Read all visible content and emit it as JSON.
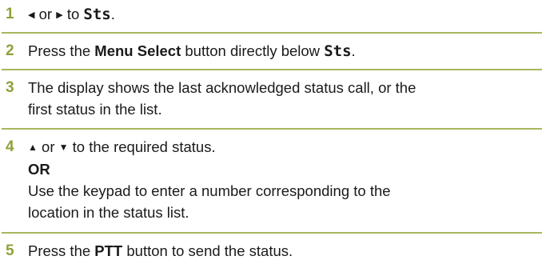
{
  "colors": {
    "accent": "#8fa13a",
    "rule": "#a8b85a",
    "text": "#1a1a1a"
  },
  "steps": [
    {
      "number": "1",
      "left_arrow_icon": "left-triangle-icon",
      "left_arrow": "◀",
      "or": "or",
      "right_arrow_icon": "right-triangle-icon",
      "right_arrow": "▶",
      "to": "to",
      "target": "Sts",
      "end": "."
    },
    {
      "number": "2",
      "pre": "Press the",
      "bold": "Menu Select",
      "mid": "button directly below",
      "target": "Sts",
      "end": "."
    },
    {
      "number": "3",
      "line1": "The display shows the last acknowledged status call, or the",
      "line2": "first status in the list."
    },
    {
      "number": "4",
      "up_icon": "up-triangle-icon",
      "up": "▲",
      "or": "or",
      "down_icon": "down-triangle-icon",
      "down": "▼",
      "rest": "to the required status.",
      "or_bold": "OR",
      "line3": "Use the keypad to enter a number corresponding to the",
      "line4": "location in the status list."
    },
    {
      "number": "5",
      "pre": "Press the",
      "bold": "PTT",
      "post": "button to send the status."
    }
  ]
}
